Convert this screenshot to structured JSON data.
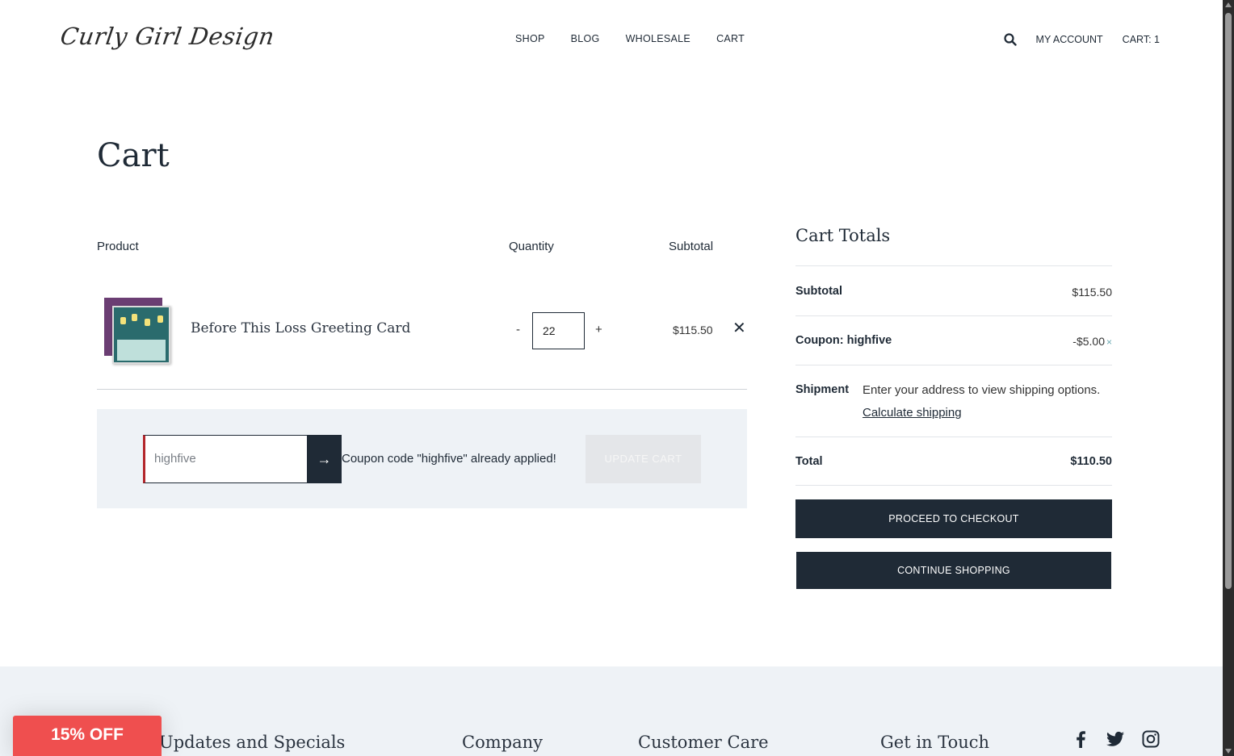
{
  "brand": {
    "logo_text": "Curly Girl Design"
  },
  "nav": {
    "items": [
      {
        "label": "SHOP"
      },
      {
        "label": "BLOG"
      },
      {
        "label": "WHOLESALE"
      },
      {
        "label": "CART"
      }
    ],
    "account_label": "MY ACCOUNT",
    "cart_label": "CART: 1"
  },
  "page": {
    "title": "Cart"
  },
  "cart_table": {
    "headers": {
      "product": "Product",
      "quantity": "Quantity",
      "subtotal": "Subtotal"
    },
    "items": [
      {
        "name": "Before This Loss Greeting Card",
        "quantity": "22",
        "subtotal": "$115.50",
        "minus": "-",
        "plus": "+",
        "remove": "✕"
      }
    ]
  },
  "coupon": {
    "value": "highfive",
    "apply_icon": "→",
    "message": "Coupon code \"highfive\" already applied!",
    "update_label": "UPDATE CART"
  },
  "totals": {
    "title": "Cart Totals",
    "subtotal_label": "Subtotal",
    "subtotal_value": "$115.50",
    "coupon_label": "Coupon: highfive",
    "coupon_value": "-$5.00",
    "coupon_remove": "×",
    "shipment_label": "Shipment",
    "shipment_text": "Enter your address to view shipping options.",
    "shipment_link": "Calculate shipping",
    "total_label": "Total",
    "total_value": "$110.50",
    "checkout_label": "PROCEED TO CHECKOUT",
    "continue_label": "CONTINUE SHOPPING"
  },
  "footer": {
    "columns": [
      {
        "title": "Updates and Specials"
      },
      {
        "title": "Company"
      },
      {
        "title": "Customer Care"
      },
      {
        "title": "Get in Touch"
      }
    ],
    "social": [
      "facebook-icon",
      "twitter-icon",
      "instagram-icon"
    ]
  },
  "promo": {
    "label": "15% OFF"
  },
  "colors": {
    "primary_dark": "#1f2a36",
    "promo_red": "#ef4f4f",
    "panel_bg": "#eef2f6"
  }
}
